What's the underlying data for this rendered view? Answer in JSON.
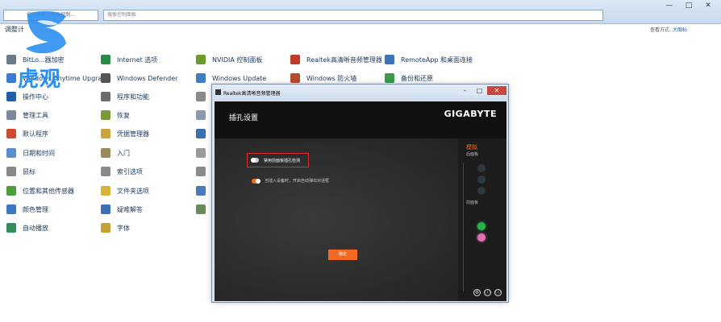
{
  "explorer": {
    "address_text": "控制面板 › 所有控制...",
    "search_placeholder": "搜索控制面板",
    "heading": "调整计",
    "view_label": "查看方式:",
    "view_value": "大图标",
    "window_controls": [
      "—",
      "□",
      "✕"
    ]
  },
  "items": [
    {
      "label": "BitLo...器加密",
      "color": "#6c7a89"
    },
    {
      "label": "Windows Anytime Upgrade",
      "color": "#3a7bd5"
    },
    {
      "label": "操作中心",
      "color": "#1f5fa8"
    },
    {
      "label": "管理工具",
      "color": "#7a8a9a"
    },
    {
      "label": "默认程序",
      "color": "#d04a2c"
    },
    {
      "label": "日期和时间",
      "color": "#5a8fc7"
    },
    {
      "label": "鼠标",
      "color": "#888888"
    },
    {
      "label": "位置和其他传感器",
      "color": "#4f9d3a"
    },
    {
      "label": "颜色管理",
      "color": "#3b78c4"
    },
    {
      "label": "自动播放",
      "color": "#2f8f5a"
    },
    {
      "label": "Internet 选项",
      "color": "#2a8a4a"
    },
    {
      "label": "Windows Defender",
      "color": "#555555"
    },
    {
      "label": "程序和功能",
      "color": "#6b6b6b"
    },
    {
      "label": "恢复",
      "color": "#7a9a3a"
    },
    {
      "label": "凭据管理器",
      "color": "#c8a43a"
    },
    {
      "label": "入门",
      "color": "#9a8a5a"
    },
    {
      "label": "索引选项",
      "color": "#8a8a8a"
    },
    {
      "label": "文件夹选项",
      "color": "#d9b13b"
    },
    {
      "label": "疑难解答",
      "color": "#3b6fb6"
    },
    {
      "label": "字体",
      "color": "#c9a030"
    },
    {
      "label": "NVIDIA 控制面板",
      "color": "#6c9a2e"
    },
    {
      "label": "Windows Update",
      "color": "#3f7fc0"
    },
    {
      "label": "Realtek高清晰音频管理器",
      "color": "#c0392b"
    },
    {
      "label": "Windows 防火墙",
      "color": "#b84a2a"
    },
    {
      "label": "RemoteApp 和桌面连接",
      "color": "#3a73b8"
    },
    {
      "label": "备份和还原",
      "color": "#3c9a4a"
    }
  ],
  "realtek": {
    "window_title": "Realtek高清晰音频管理器",
    "window_buttons": [
      "–",
      "□",
      "✕"
    ],
    "section_title": "插孔设置",
    "brand": "GIGABYTE",
    "option_disable_front": "禁用前面板插孔检测",
    "option_auto_popup": "当插入设备时，开启自动弹出对话框",
    "ok_button": "确定",
    "side_title": "模拟",
    "side_rear": "后面板",
    "side_front": "前面板",
    "footer_icons": [
      "⚙",
      "ⓘ",
      "ⓘ"
    ],
    "jack_colors": {
      "green": "#29b34a",
      "pink": "#e36fb2",
      "accent": "#f26a21"
    }
  },
  "watermark": {
    "text": "虎观"
  }
}
